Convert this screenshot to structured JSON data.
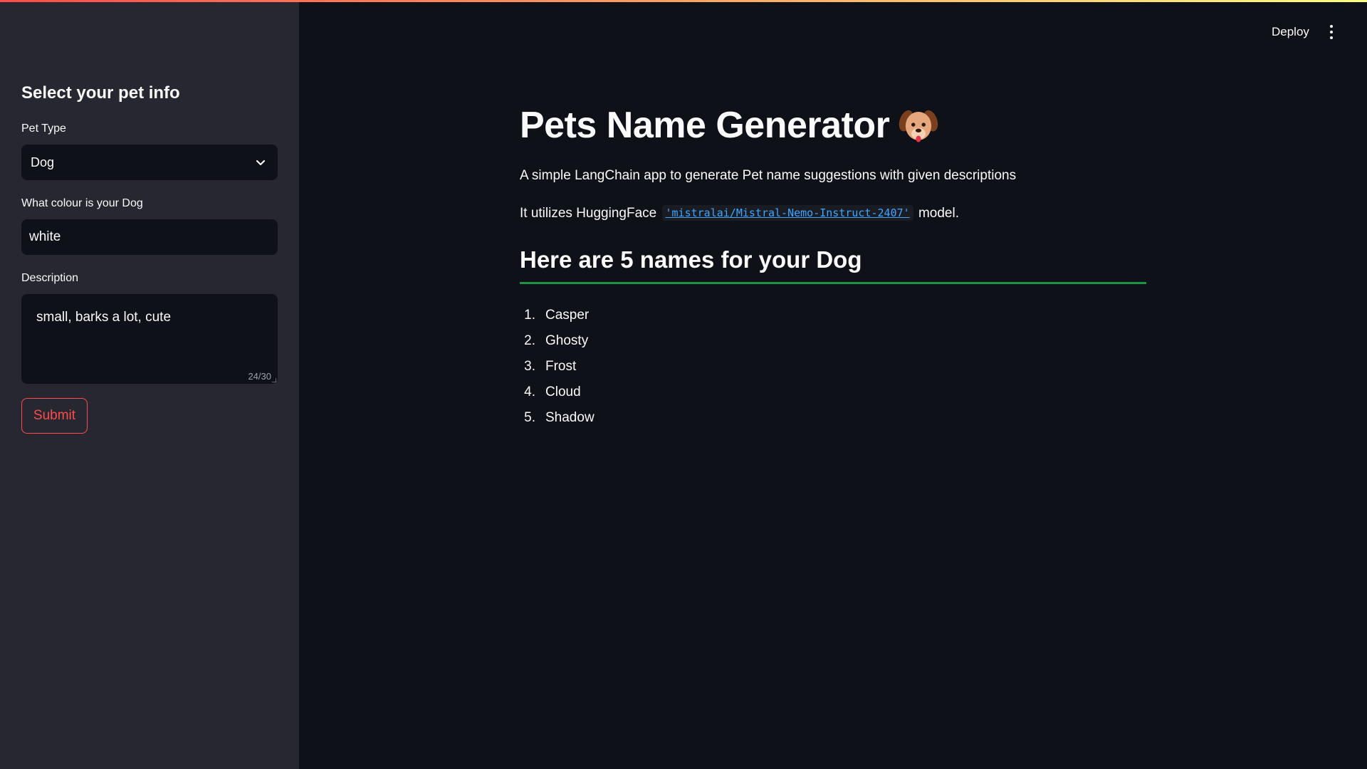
{
  "sidebar": {
    "title": "Select your pet info",
    "pet_type": {
      "label": "Pet Type",
      "value": "Dog"
    },
    "colour": {
      "label": "What colour is your Dog",
      "value": "white"
    },
    "description": {
      "label": "Description",
      "value": "small, barks a lot, cute",
      "counter": "24/30"
    },
    "submit_label": "Submit"
  },
  "header": {
    "deploy_label": "Deploy",
    "menu_icon": "kebab-menu-icon"
  },
  "main": {
    "title": "Pets Name Generator",
    "title_icon": "dog-face-icon",
    "intro": "A simple LangChain app to generate Pet name suggestions with given descriptions",
    "utilizes_prefix": "It utilizes HuggingFace",
    "model_code": "'mistralai/Mistral-Nemo-Instruct-2407'",
    "utilizes_suffix": "model.",
    "subheader": "Here are 5 names for your Dog",
    "names": [
      {
        "num": "1.",
        "name": "Casper"
      },
      {
        "num": "2.",
        "name": "Ghosty"
      },
      {
        "num": "3.",
        "name": "Frost"
      },
      {
        "num": "4.",
        "name": "Cloud"
      },
      {
        "num": "5.",
        "name": "Shadow"
      }
    ]
  },
  "colors": {
    "accent": "#ff4b4b",
    "divider": "#21c354",
    "link": "#3ea6ff",
    "sidebar_bg": "#262730",
    "main_bg": "#0e1117"
  }
}
